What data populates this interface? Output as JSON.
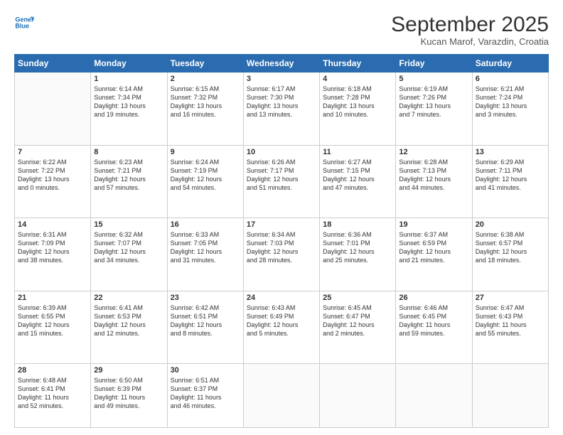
{
  "logo": {
    "line1": "General",
    "line2": "Blue"
  },
  "title": "September 2025",
  "location": "Kucan Marof, Varazdin, Croatia",
  "days_header": [
    "Sunday",
    "Monday",
    "Tuesday",
    "Wednesday",
    "Thursday",
    "Friday",
    "Saturday"
  ],
  "weeks": [
    [
      {
        "num": "",
        "info": ""
      },
      {
        "num": "1",
        "info": "Sunrise: 6:14 AM\nSunset: 7:34 PM\nDaylight: 13 hours\nand 19 minutes."
      },
      {
        "num": "2",
        "info": "Sunrise: 6:15 AM\nSunset: 7:32 PM\nDaylight: 13 hours\nand 16 minutes."
      },
      {
        "num": "3",
        "info": "Sunrise: 6:17 AM\nSunset: 7:30 PM\nDaylight: 13 hours\nand 13 minutes."
      },
      {
        "num": "4",
        "info": "Sunrise: 6:18 AM\nSunset: 7:28 PM\nDaylight: 13 hours\nand 10 minutes."
      },
      {
        "num": "5",
        "info": "Sunrise: 6:19 AM\nSunset: 7:26 PM\nDaylight: 13 hours\nand 7 minutes."
      },
      {
        "num": "6",
        "info": "Sunrise: 6:21 AM\nSunset: 7:24 PM\nDaylight: 13 hours\nand 3 minutes."
      }
    ],
    [
      {
        "num": "7",
        "info": "Sunrise: 6:22 AM\nSunset: 7:22 PM\nDaylight: 13 hours\nand 0 minutes."
      },
      {
        "num": "8",
        "info": "Sunrise: 6:23 AM\nSunset: 7:21 PM\nDaylight: 12 hours\nand 57 minutes."
      },
      {
        "num": "9",
        "info": "Sunrise: 6:24 AM\nSunset: 7:19 PM\nDaylight: 12 hours\nand 54 minutes."
      },
      {
        "num": "10",
        "info": "Sunrise: 6:26 AM\nSunset: 7:17 PM\nDaylight: 12 hours\nand 51 minutes."
      },
      {
        "num": "11",
        "info": "Sunrise: 6:27 AM\nSunset: 7:15 PM\nDaylight: 12 hours\nand 47 minutes."
      },
      {
        "num": "12",
        "info": "Sunrise: 6:28 AM\nSunset: 7:13 PM\nDaylight: 12 hours\nand 44 minutes."
      },
      {
        "num": "13",
        "info": "Sunrise: 6:29 AM\nSunset: 7:11 PM\nDaylight: 12 hours\nand 41 minutes."
      }
    ],
    [
      {
        "num": "14",
        "info": "Sunrise: 6:31 AM\nSunset: 7:09 PM\nDaylight: 12 hours\nand 38 minutes."
      },
      {
        "num": "15",
        "info": "Sunrise: 6:32 AM\nSunset: 7:07 PM\nDaylight: 12 hours\nand 34 minutes."
      },
      {
        "num": "16",
        "info": "Sunrise: 6:33 AM\nSunset: 7:05 PM\nDaylight: 12 hours\nand 31 minutes."
      },
      {
        "num": "17",
        "info": "Sunrise: 6:34 AM\nSunset: 7:03 PM\nDaylight: 12 hours\nand 28 minutes."
      },
      {
        "num": "18",
        "info": "Sunrise: 6:36 AM\nSunset: 7:01 PM\nDaylight: 12 hours\nand 25 minutes."
      },
      {
        "num": "19",
        "info": "Sunrise: 6:37 AM\nSunset: 6:59 PM\nDaylight: 12 hours\nand 21 minutes."
      },
      {
        "num": "20",
        "info": "Sunrise: 6:38 AM\nSunset: 6:57 PM\nDaylight: 12 hours\nand 18 minutes."
      }
    ],
    [
      {
        "num": "21",
        "info": "Sunrise: 6:39 AM\nSunset: 6:55 PM\nDaylight: 12 hours\nand 15 minutes."
      },
      {
        "num": "22",
        "info": "Sunrise: 6:41 AM\nSunset: 6:53 PM\nDaylight: 12 hours\nand 12 minutes."
      },
      {
        "num": "23",
        "info": "Sunrise: 6:42 AM\nSunset: 6:51 PM\nDaylight: 12 hours\nand 8 minutes."
      },
      {
        "num": "24",
        "info": "Sunrise: 6:43 AM\nSunset: 6:49 PM\nDaylight: 12 hours\nand 5 minutes."
      },
      {
        "num": "25",
        "info": "Sunrise: 6:45 AM\nSunset: 6:47 PM\nDaylight: 12 hours\nand 2 minutes."
      },
      {
        "num": "26",
        "info": "Sunrise: 6:46 AM\nSunset: 6:45 PM\nDaylight: 11 hours\nand 59 minutes."
      },
      {
        "num": "27",
        "info": "Sunrise: 6:47 AM\nSunset: 6:43 PM\nDaylight: 11 hours\nand 55 minutes."
      }
    ],
    [
      {
        "num": "28",
        "info": "Sunrise: 6:48 AM\nSunset: 6:41 PM\nDaylight: 11 hours\nand 52 minutes."
      },
      {
        "num": "29",
        "info": "Sunrise: 6:50 AM\nSunset: 6:39 PM\nDaylight: 11 hours\nand 49 minutes."
      },
      {
        "num": "30",
        "info": "Sunrise: 6:51 AM\nSunset: 6:37 PM\nDaylight: 11 hours\nand 46 minutes."
      },
      {
        "num": "",
        "info": ""
      },
      {
        "num": "",
        "info": ""
      },
      {
        "num": "",
        "info": ""
      },
      {
        "num": "",
        "info": ""
      }
    ]
  ]
}
